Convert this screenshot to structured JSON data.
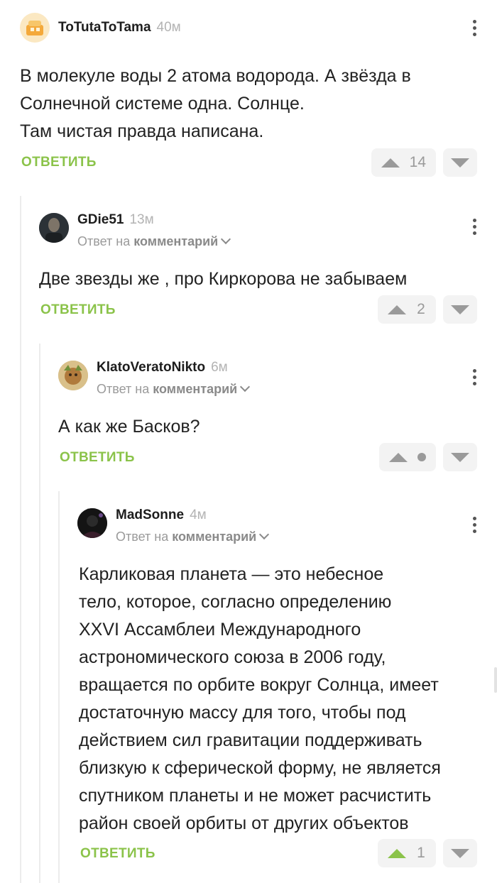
{
  "comments": [
    {
      "author": "ToTutaToTama",
      "time": "40м",
      "reply_prefix": "",
      "reply_target": "",
      "text": "В молекуле воды 2 атома водорода. А звёзда в\nСолнечной системе одна. Солнце.\nТам чистая правда написана.",
      "reply_label": "ОТВЕТИТЬ",
      "votes": "14",
      "upvoted": false
    },
    {
      "author": "GDie51",
      "time": "13м",
      "reply_prefix": "Ответ на",
      "reply_target": "комментарий",
      "text": "Две звезды же , про Киркорова не забываем",
      "reply_label": "ОТВЕТИТЬ",
      "votes": "2",
      "upvoted": false
    },
    {
      "author": "KlatoVeratoNikto",
      "time": "6м",
      "reply_prefix": "Ответ на",
      "reply_target": "комментарий",
      "text": "А как же Басков?",
      "reply_label": "ОТВЕТИТЬ",
      "votes": "",
      "upvoted": false
    },
    {
      "author": "MadSonne",
      "time": "4м",
      "reply_prefix": "Ответ на",
      "reply_target": "комментарий",
      "text": "Карликовая планета — это небесное\nтело, которое, согласно определению\nXXVI Ассамблеи Международного\nастрономического союза в 2006 году,\nвращается по орбите вокруг Солнца, имеет\nдостаточную массу для того, чтобы под\nдействием сил гравитации поддерживать\nблизкую к сферической форму, не является\nспутником планеты и не может расчистить\nрайон своей орбиты от других объектов",
      "reply_label": "ОТВЕТИТЬ",
      "votes": "1",
      "upvoted": true
    }
  ],
  "colors": {
    "accent": "#8bc34a",
    "muted": "#9a9a9a",
    "vote_bg": "#f3f3f3"
  },
  "icons": {
    "menu": "more-vertical-icon",
    "upvote": "upvote-triangle-icon",
    "downvote": "downvote-triangle-icon",
    "reply_chevron": "chevron-down-icon"
  }
}
